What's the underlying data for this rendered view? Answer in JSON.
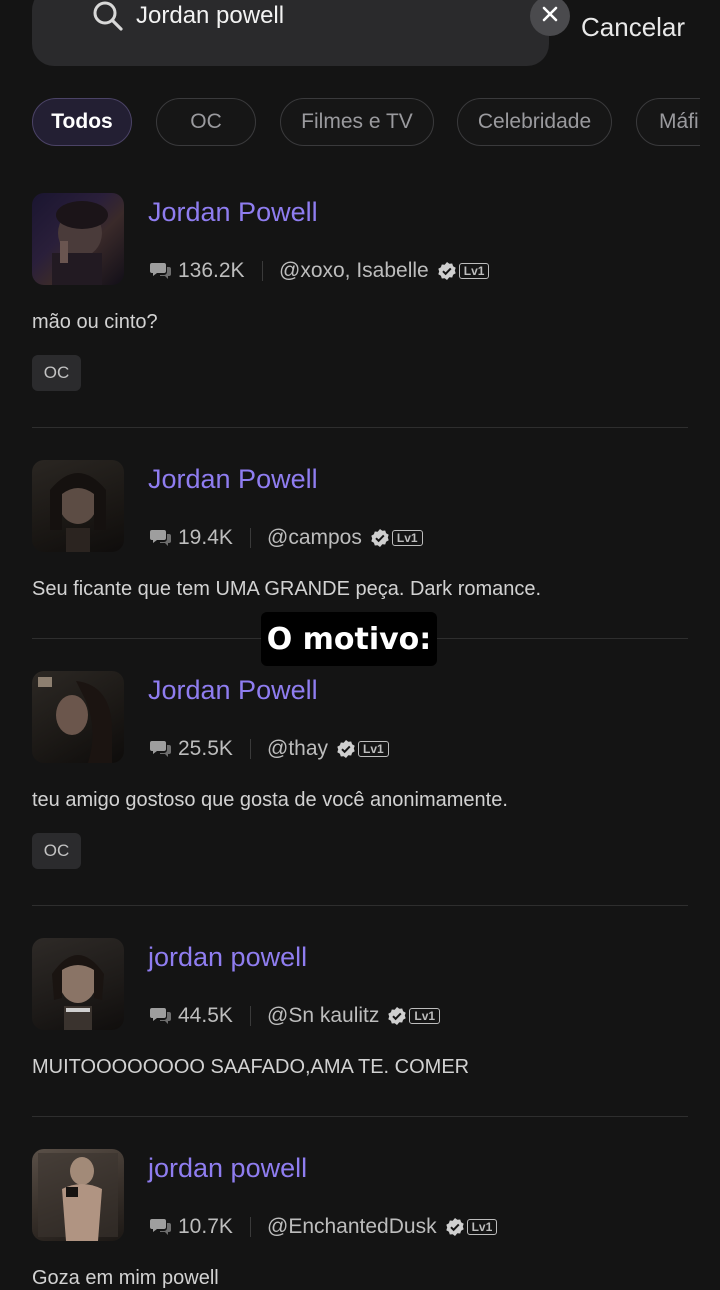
{
  "search": {
    "value": "Jordan powell",
    "cancel_label": "Cancelar"
  },
  "filters": [
    "Todos",
    "OC",
    "Filmes e TV",
    "Celebridade",
    "Máfi"
  ],
  "active_filter": "Todos",
  "caption": "O motivo:",
  "results": [
    {
      "name": "Jordan Powell",
      "count": "136.2K",
      "author": "@xoxo, Isabelle",
      "level": "Lv1",
      "description": "mão ou cinto?",
      "tag": "OC"
    },
    {
      "name": "Jordan Powell",
      "count": "19.4K",
      "author": "@campos",
      "level": "Lv1",
      "description": "Seu ficante que tem UMA GRANDE peça. Dark romance."
    },
    {
      "name": "Jordan Powell",
      "count": "25.5K",
      "author": "@thay",
      "level": "Lv1",
      "description": "teu amigo gostoso que gosta de você anonimamente.",
      "tag": "OC"
    },
    {
      "name": "jordan powell",
      "count": "44.5K",
      "author": "@Sn kaulitz",
      "level": "Lv1",
      "description": "MUITOOOOOOOO SAAFADO,AMA TE. COMER"
    },
    {
      "name": "jordan powell",
      "count": "10.7K",
      "author": "@EnchantedDusk",
      "level": "Lv1",
      "description": "Goza em mim powell"
    }
  ],
  "colors": {
    "accent": "#8f7df0",
    "background": "#141414",
    "chip_active": "#231f33"
  }
}
